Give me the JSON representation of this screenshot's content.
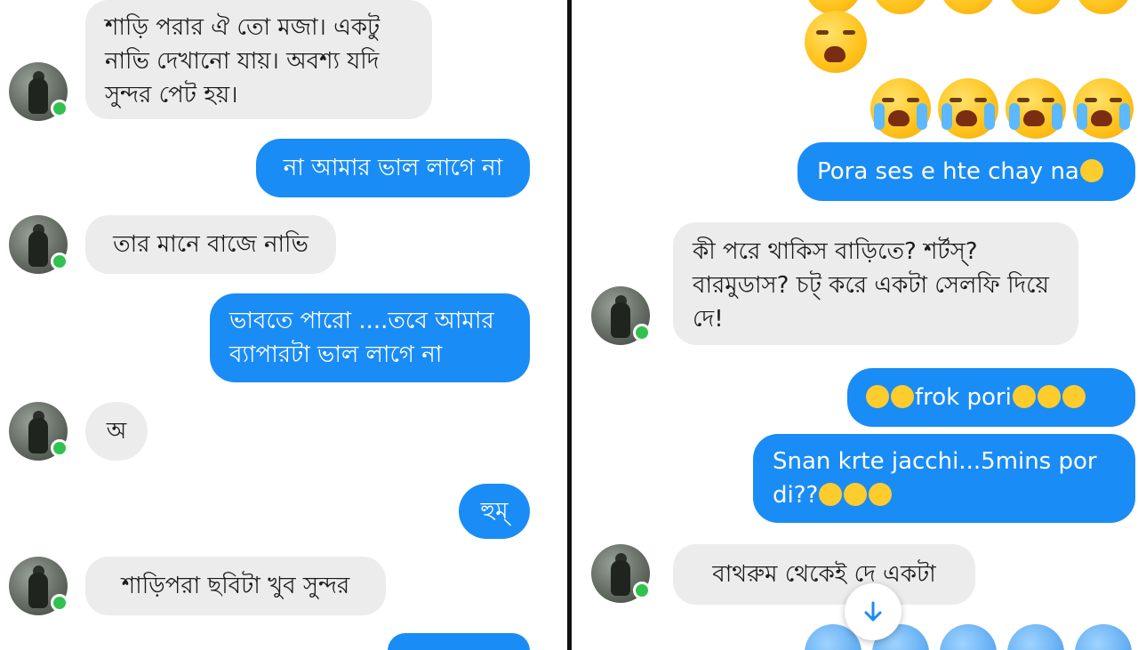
{
  "left": {
    "messages": [
      {
        "dir": "in",
        "text": "শাড়ি পরার ঐ তো মজা। একটু নাভি দেখানো যায়। অবশ্য যদি সুন্দর পেট হয়।"
      },
      {
        "dir": "out",
        "text": "না আমার ভাল লাগে না"
      },
      {
        "dir": "in",
        "text": "তার মানে বাজে নাভি"
      },
      {
        "dir": "out",
        "text": "ভাবতে পারো ....তবে আমার ব্যাপারটা ভাল লাগে না"
      },
      {
        "dir": "in",
        "text": "অ"
      },
      {
        "dir": "out",
        "text": "হুম্"
      },
      {
        "dir": "in",
        "text": "শাড়িপরা ছবিটা খুব সুন্দর"
      }
    ]
  },
  "right": {
    "messages": [
      {
        "dir": "out",
        "text": "Pora ses e hte chay na"
      },
      {
        "dir": "in",
        "text": "কী পরে থাকিস বাড়িতে? শর্টস্? বারমুডাস? চট্ করে একটা সেলফি দিয়ে দে!"
      },
      {
        "dir": "out",
        "text": "frok pori"
      },
      {
        "dir": "out",
        "text": "Snan krte jacchi...5mins por di??"
      },
      {
        "dir": "in",
        "text": "বাথরুম থেকেই দে একটা"
      }
    ],
    "emojis": {
      "tired": "weary-face-emoji",
      "crying": "loudly-crying-face-emoji",
      "grinning": "grinning-face-emoji",
      "cold": "cold-sweat-face-emoji"
    }
  },
  "colors": {
    "outgoing_bubble": "#1a8cf5",
    "incoming_bubble": "#ececec",
    "online_dot": "#31c24d",
    "divider": "#111111"
  },
  "icons": {
    "scroll_down": "arrow-down-icon",
    "avatar": "contact-avatar"
  }
}
